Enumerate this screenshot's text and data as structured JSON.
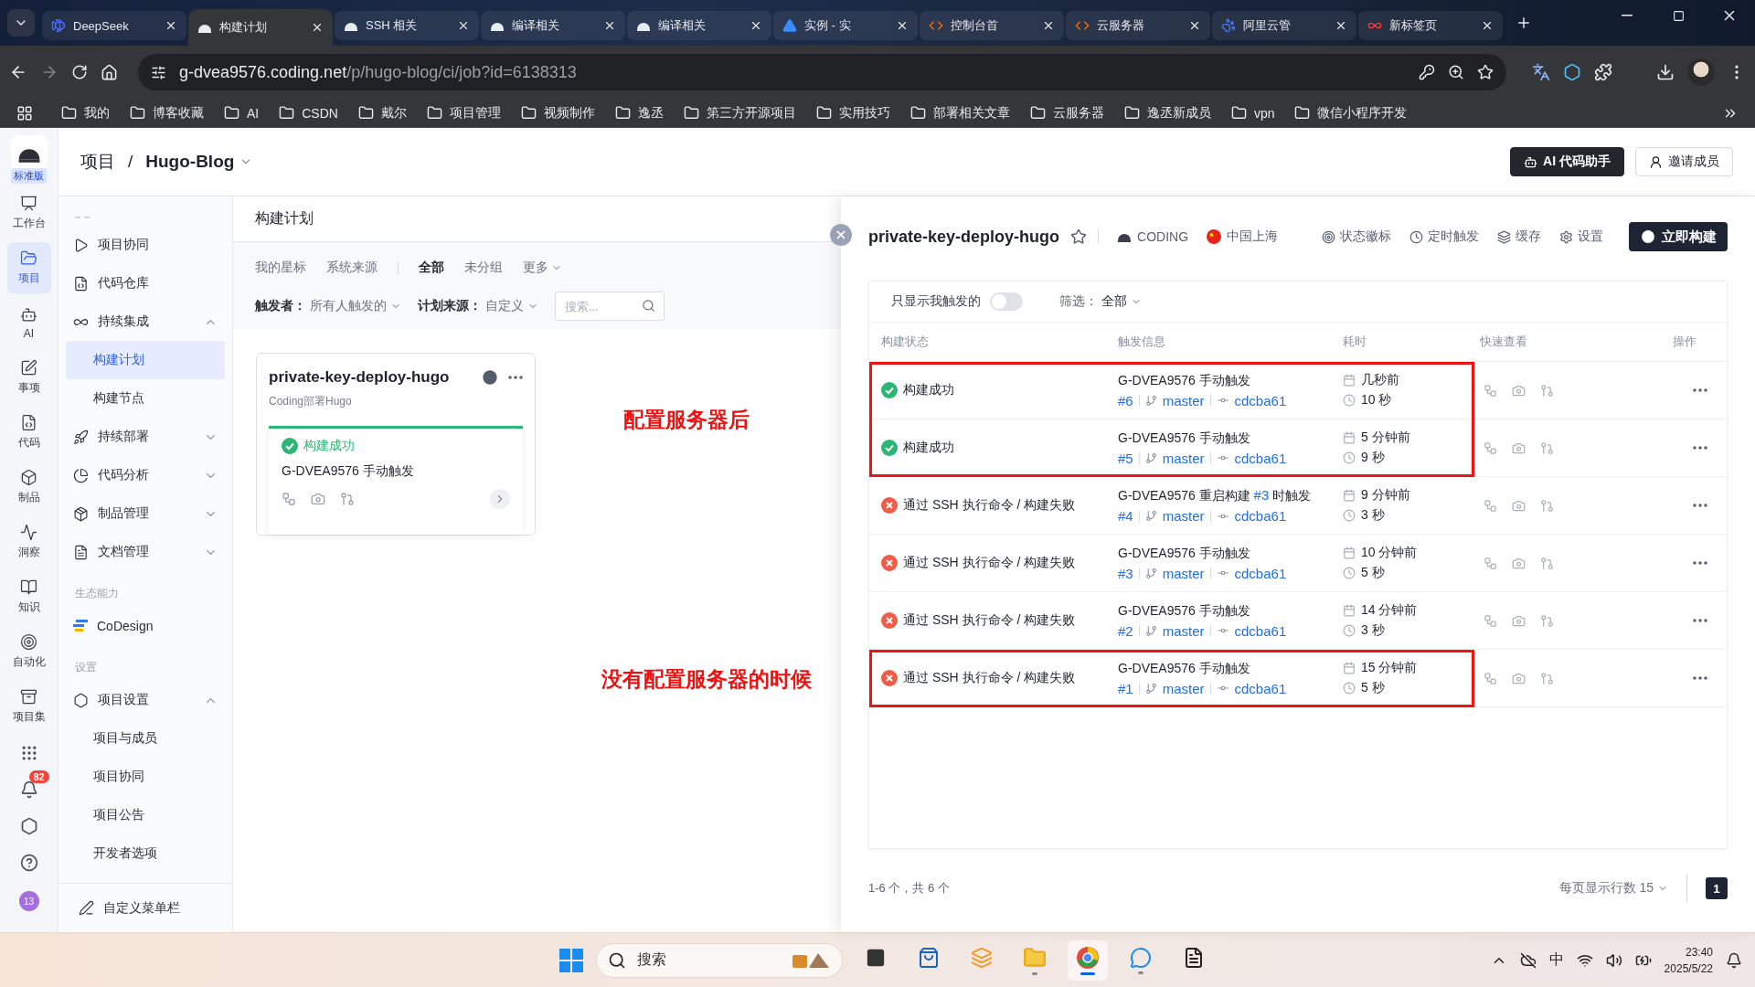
{
  "browser": {
    "tabs": [
      {
        "title": "DeepSeek",
        "selected": false
      },
      {
        "title": "构建计划",
        "selected": true
      },
      {
        "title": "SSH 相关",
        "selected": false
      },
      {
        "title": "编译相关",
        "selected": false
      },
      {
        "title": "编译相关",
        "selected": false
      },
      {
        "title": "实例 - 实",
        "selected": false
      },
      {
        "title": "控制台首",
        "selected": false
      },
      {
        "title": "云服务器",
        "selected": false
      },
      {
        "title": "阿里云管",
        "selected": false
      },
      {
        "title": "新标签页",
        "selected": false
      }
    ],
    "url": {
      "host": "g-dvea9576.coding.net",
      "path": "/p/hugo-blog/ci/job?id=6138313"
    },
    "bookmarks": [
      "我的",
      "博客收藏",
      "AI",
      "CSDN",
      "戴尔",
      "项目管理",
      "视频制作",
      "逸丞",
      "第三方开源项目",
      "实用技巧",
      "部署相关文章",
      "云服务器",
      "逸丞新成员",
      "vpn",
      "微信小程序开发"
    ]
  },
  "rail": {
    "edition": "标准版",
    "items": [
      {
        "label": "工作台",
        "selected": false
      },
      {
        "label": "项目",
        "selected": true
      },
      {
        "label": "AI",
        "selected": false
      },
      {
        "label": "事项",
        "selected": false
      },
      {
        "label": "代码",
        "selected": false
      },
      {
        "label": "制品",
        "selected": false
      },
      {
        "label": "洞察",
        "selected": false
      },
      {
        "label": "知识",
        "selected": false
      },
      {
        "label": "自动化",
        "selected": false
      },
      {
        "label": "项目集",
        "selected": false
      }
    ],
    "notifications": "82",
    "avatar": "13"
  },
  "header": {
    "breadcrumb": "项目",
    "separator": "/",
    "project": "Hugo-Blog",
    "buttons": [
      "AI 代码助手",
      "邀请成员"
    ]
  },
  "sidebar": {
    "items": [
      {
        "kind": "item",
        "label": "项目协同",
        "selected": false
      },
      {
        "kind": "item",
        "label": "代码仓库",
        "selected": false
      },
      {
        "kind": "group",
        "label": "持续集成",
        "expanded": true,
        "selected": false,
        "children": [
          {
            "label": "构建计划",
            "selected": true
          },
          {
            "label": "构建节点",
            "selected": false
          }
        ]
      },
      {
        "kind": "group",
        "label": "持续部署",
        "expanded": false,
        "selected": false
      },
      {
        "kind": "group",
        "label": "代码分析",
        "expanded": false,
        "selected": false
      },
      {
        "kind": "group",
        "label": "制品管理",
        "expanded": false,
        "selected": false
      },
      {
        "kind": "group",
        "label": "文档管理",
        "expanded": false,
        "selected": false
      },
      {
        "kind": "section",
        "label": "生态能力"
      },
      {
        "kind": "item",
        "label": "CoDesign",
        "selected": false
      },
      {
        "kind": "section",
        "label": "设置"
      },
      {
        "kind": "group",
        "label": "项目设置",
        "expanded": true,
        "selected": false,
        "children": [
          {
            "label": "项目与成员",
            "selected": false
          },
          {
            "label": "项目协同",
            "selected": false
          },
          {
            "label": "项目公告",
            "selected": false
          },
          {
            "label": "开发者选项",
            "selected": false
          }
        ]
      }
    ],
    "footer": "自定义菜单栏"
  },
  "plans": {
    "title": "构建计划",
    "scope_tabs": [
      {
        "label": "我的星标",
        "selected": false
      },
      {
        "label": "系统来源",
        "selected": false
      }
    ],
    "group_tabs": [
      {
        "label": "全部",
        "selected": true
      },
      {
        "label": "未分组",
        "selected": false
      }
    ],
    "more": "更多",
    "filters": [
      {
        "label": "触发者：",
        "value": "所有人触发的"
      },
      {
        "label": "计划来源：",
        "value": "自定义"
      }
    ],
    "search_placeholder": "搜索...",
    "card": {
      "name": "private-key-deploy-hugo",
      "description": "Coding部署Hugo",
      "kind": "success",
      "status_text": "构建成功",
      "trigger": "G-DVEA9576 手动触发"
    }
  },
  "annotations": [
    "配置服务器后",
    "没有配置服务器的时候"
  ],
  "job": {
    "title": "private-key-deploy-hugo",
    "starred": false,
    "source": "CODING",
    "region": "中国上海",
    "actions": [
      "状态徽标",
      "定时触发",
      "缓存",
      "设置"
    ],
    "primary": "立即构建",
    "only_mine": {
      "label": "只显示我触发的",
      "on": false
    },
    "filter": {
      "label": "筛选：",
      "value": "全部"
    },
    "columns": [
      "构建状态",
      "触发信息",
      "耗时",
      "快速查看",
      "操作"
    ],
    "rows": [
      {
        "kind": "success",
        "status_text": "构建成功",
        "trigger": "G-DVEA9576 手动触发",
        "number": "#6",
        "branch": "master",
        "commit": "cdcba61",
        "time": "几秒前",
        "duration": "10 秒",
        "highlighted": true
      },
      {
        "kind": "success",
        "status_text": "构建成功",
        "trigger": "G-DVEA9576 手动触发",
        "number": "#5",
        "branch": "master",
        "commit": "cdcba61",
        "time": "5 分钟前",
        "duration": "9 秒",
        "highlighted": true
      },
      {
        "kind": "failure",
        "status_text": "通过 SSH 执行命令 / 构建失败",
        "trigger": "G-DVEA9576 重启构建",
        "trigger_ref": "#3",
        "trigger_suffix": "时触发",
        "number": "#4",
        "branch": "master",
        "commit": "cdcba61",
        "time": "9 分钟前",
        "duration": "3 秒",
        "highlighted": false
      },
      {
        "kind": "failure",
        "status_text": "通过 SSH 执行命令 / 构建失败",
        "trigger": "G-DVEA9576 手动触发",
        "number": "#3",
        "branch": "master",
        "commit": "cdcba61",
        "time": "10 分钟前",
        "duration": "5 秒",
        "highlighted": false
      },
      {
        "kind": "failure",
        "status_text": "通过 SSH 执行命令 / 构建失败",
        "trigger": "G-DVEA9576 手动触发",
        "number": "#2",
        "branch": "master",
        "commit": "cdcba61",
        "time": "14 分钟前",
        "duration": "3 秒",
        "highlighted": false
      },
      {
        "kind": "failure",
        "status_text": "通过 SSH 执行命令 / 构建失败",
        "trigger": "G-DVEA9576 手动触发",
        "number": "#1",
        "branch": "master",
        "commit": "cdcba61",
        "time": "15 分钟前",
        "duration": "5 秒",
        "highlighted": true
      }
    ],
    "summary": "1-6 个，共 6 个",
    "page_size": "每页显示行数 15",
    "page": "1"
  },
  "taskbar": {
    "search": "搜索",
    "ime": "中",
    "time": "23:40",
    "date": "2025/5/22"
  }
}
